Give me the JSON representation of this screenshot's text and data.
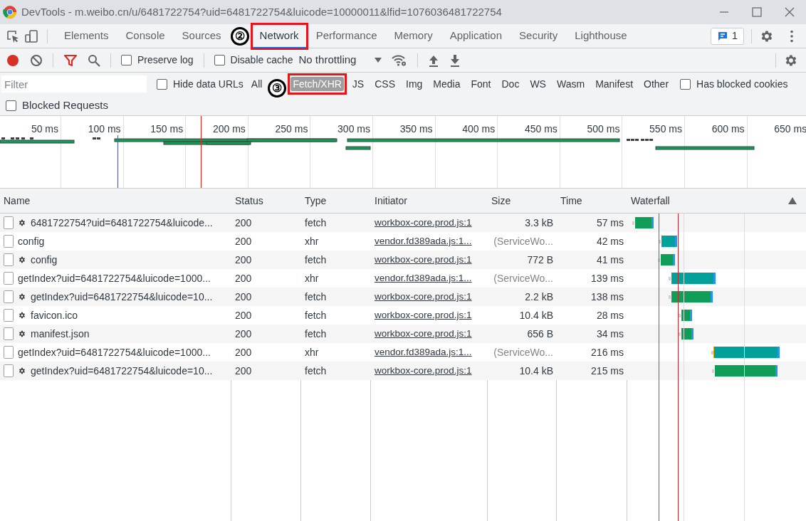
{
  "window": {
    "title": "DevTools - m.weibo.cn/u/6481722754?uid=6481722754&luicode=10000011&lfid=1076036481722754"
  },
  "tabs": [
    {
      "label": "Elements",
      "selected": false,
      "highlighted": false
    },
    {
      "label": "Console",
      "selected": false,
      "highlighted": false
    },
    {
      "label": "Sources",
      "selected": false,
      "highlighted": false
    },
    {
      "label": "Network",
      "selected": true,
      "highlighted": true
    },
    {
      "label": "Performance",
      "selected": false,
      "highlighted": false
    },
    {
      "label": "Memory",
      "selected": false,
      "highlighted": false
    },
    {
      "label": "Application",
      "selected": false,
      "highlighted": false
    },
    {
      "label": "Security",
      "selected": false,
      "highlighted": false
    },
    {
      "label": "Lighthouse",
      "selected": false,
      "highlighted": false
    }
  ],
  "issues_count": "1",
  "toolbar": {
    "preserve_log": {
      "label": "Preserve log",
      "checked": false
    },
    "disable_cache": {
      "label": "Disable cache",
      "checked": false
    },
    "throttling": "No throttling"
  },
  "filter": {
    "placeholder": "Filter",
    "hide_data_urls": {
      "label": "Hide data URLs",
      "checked": false
    },
    "types": [
      {
        "label": "All",
        "selected": false,
        "highlighted": false
      },
      {
        "label": "Fetch/XHR",
        "selected": true,
        "highlighted": true
      },
      {
        "label": "JS",
        "selected": false,
        "highlighted": false
      },
      {
        "label": "CSS",
        "selected": false,
        "highlighted": false
      },
      {
        "label": "Img",
        "selected": false,
        "highlighted": false
      },
      {
        "label": "Media",
        "selected": false,
        "highlighted": false
      },
      {
        "label": "Font",
        "selected": false,
        "highlighted": false
      },
      {
        "label": "Doc",
        "selected": false,
        "highlighted": false
      },
      {
        "label": "WS",
        "selected": false,
        "highlighted": false
      },
      {
        "label": "Wasm",
        "selected": false,
        "highlighted": false
      },
      {
        "label": "Manifest",
        "selected": false,
        "highlighted": false
      },
      {
        "label": "Other",
        "selected": false,
        "highlighted": false
      }
    ],
    "has_blocked_cookies": {
      "label": "Has blocked cookies",
      "checked": false
    },
    "blocked_requests": {
      "label": "Blocked Requests",
      "checked": false
    }
  },
  "annotations": [
    {
      "label": "②"
    },
    {
      "label": "③"
    }
  ],
  "overview": {
    "ticks": [
      "50 ms",
      "100 ms",
      "150 ms",
      "200 ms",
      "250 ms",
      "300 ms",
      "350 ms",
      "400 ms",
      "450 ms",
      "500 ms",
      "550 ms",
      "600 ms",
      "650 ms"
    ]
  },
  "table": {
    "columns": [
      "Name",
      "Status",
      "Type",
      "Initiator",
      "Size",
      "Time",
      "Waterfall"
    ],
    "rows": [
      {
        "name": "6481722754?uid=6481722754&luicode...",
        "service_worker": true,
        "status": "200",
        "type": "fetch",
        "initiator": "workbox-core.prod.js:1",
        "size": "3.3 kB",
        "time": "57 ms"
      },
      {
        "name": "config",
        "service_worker": false,
        "status": "200",
        "type": "xhr",
        "initiator": "vendor.fd389ada.js:1...",
        "size": "(ServiceWo...",
        "time": "42 ms"
      },
      {
        "name": "config",
        "service_worker": true,
        "status": "200",
        "type": "fetch",
        "initiator": "workbox-core.prod.js:1",
        "size": "772 B",
        "time": "41 ms"
      },
      {
        "name": "getIndex?uid=6481722754&luicode=1000...",
        "service_worker": false,
        "status": "200",
        "type": "xhr",
        "initiator": "vendor.fd389ada.js:1...",
        "size": "(ServiceWo...",
        "time": "139 ms"
      },
      {
        "name": "getIndex?uid=6481722754&luicode=10...",
        "service_worker": true,
        "status": "200",
        "type": "fetch",
        "initiator": "workbox-core.prod.js:1",
        "size": "2.2 kB",
        "time": "138 ms"
      },
      {
        "name": "favicon.ico",
        "service_worker": true,
        "status": "200",
        "type": "fetch",
        "initiator": "workbox-core.prod.js:1",
        "size": "10.4 kB",
        "time": "28 ms"
      },
      {
        "name": "manifest.json",
        "service_worker": true,
        "status": "200",
        "type": "fetch",
        "initiator": "workbox-core.prod.js:1",
        "size": "656 B",
        "time": "34 ms"
      },
      {
        "name": "getIndex?uid=6481722754&luicode=1000...",
        "service_worker": false,
        "status": "200",
        "type": "xhr",
        "initiator": "vendor.fd389ada.js:1...",
        "size": "(ServiceWo...",
        "time": "216 ms"
      },
      {
        "name": "getIndex?uid=6481722754&luicode=10...",
        "service_worker": true,
        "status": "200",
        "type": "fetch",
        "initiator": "workbox-core.prod.js:1",
        "size": "10.4 kB",
        "time": "215 ms"
      }
    ]
  }
}
